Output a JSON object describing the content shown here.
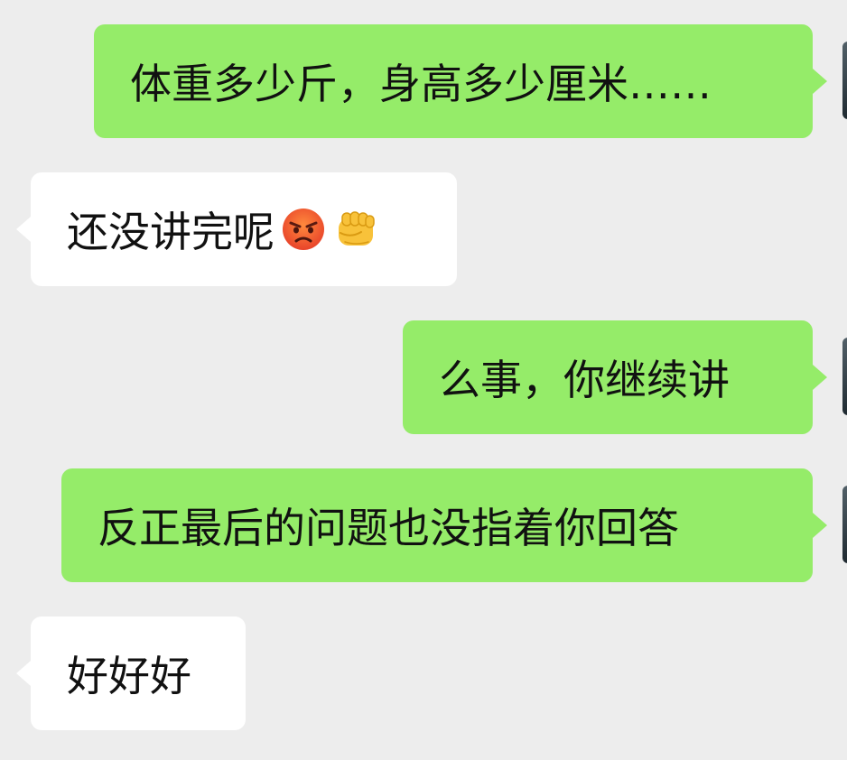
{
  "chat": {
    "messages": [
      {
        "side": "sent",
        "text": "体重多少斤，身高多少厘米……"
      },
      {
        "side": "received",
        "text": "还没讲完呢",
        "emojis": [
          "angry-face-icon",
          "fist-bump-icon"
        ]
      },
      {
        "side": "sent",
        "text": "么事，你继续讲"
      },
      {
        "side": "sent",
        "text": "反正最后的问题也没指着你回答"
      },
      {
        "side": "received",
        "text": "好好好"
      }
    ]
  },
  "colors": {
    "background": "#ededed",
    "sent_bubble": "#95ec69",
    "received_bubble": "#ffffff",
    "text": "#111111"
  }
}
